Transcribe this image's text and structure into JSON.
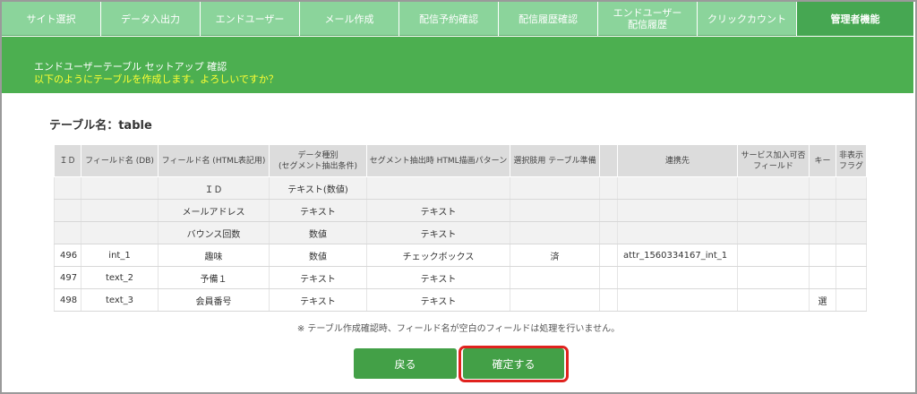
{
  "nav": {
    "tabs": [
      {
        "label": "サイト選択",
        "label2": ""
      },
      {
        "label": "データ入出力",
        "label2": ""
      },
      {
        "label": "エンドユーザー",
        "label2": ""
      },
      {
        "label": "メール作成",
        "label2": ""
      },
      {
        "label": "配信予約確認",
        "label2": ""
      },
      {
        "label": "配信履歴確認",
        "label2": ""
      },
      {
        "label": "エンドユーザー",
        "label2": "配信履歴"
      },
      {
        "label": "クリックカウント",
        "label2": ""
      },
      {
        "label": "管理者機能",
        "label2": ""
      }
    ]
  },
  "header": {
    "title": "エンドユーザーテーブル セットアップ 確認",
    "subtitle": "以下のようにテーブルを作成します。よろしいですか？"
  },
  "table_name": "テーブル名：table",
  "table": {
    "headers": [
      {
        "line1": "ＩＤ",
        "line2": ""
      },
      {
        "line1": "フィールド名 (DB)",
        "line2": ""
      },
      {
        "line1": "フィールド名 (HTML表記用)",
        "line2": ""
      },
      {
        "line1": "データ種別",
        "line2": "(セグメント抽出条件)"
      },
      {
        "line1": "セグメント抽出時 HTML描画パターン",
        "line2": ""
      },
      {
        "line1": "選択肢用 テーブル準備",
        "line2": ""
      },
      {
        "line1": "",
        "line2": ""
      },
      {
        "line1": "連携先",
        "line2": ""
      },
      {
        "line1": "サービス加入可否",
        "line2": "フィールド"
      },
      {
        "line1": "キー",
        "line2": ""
      },
      {
        "line1": "非表示",
        "line2": "フラグ"
      }
    ],
    "rows": [
      {
        "id": "",
        "db": "",
        "html": "ＩＤ",
        "type": "テキスト(数値)",
        "pattern": "",
        "prep": "",
        "blank": "",
        "link": "",
        "service": "",
        "key": "",
        "hidden": ""
      },
      {
        "id": "",
        "db": "",
        "html": "メールアドレス",
        "type": "テキスト",
        "pattern": "テキスト",
        "prep": "",
        "blank": "",
        "link": "",
        "service": "",
        "key": "",
        "hidden": ""
      },
      {
        "id": "",
        "db": "",
        "html": "バウンス回数",
        "type": "数値",
        "pattern": "テキスト",
        "prep": "",
        "blank": "",
        "link": "",
        "service": "",
        "key": "",
        "hidden": ""
      },
      {
        "id": "496",
        "db": "int_1",
        "html": "趣味",
        "type": "数値",
        "pattern": "チェックボックス",
        "prep": "済",
        "blank": "",
        "link": "attr_1560334167_int_1",
        "service": "",
        "key": "",
        "hidden": ""
      },
      {
        "id": "497",
        "db": "text_2",
        "html": "予備１",
        "type": "テキスト",
        "pattern": "テキスト",
        "prep": "",
        "blank": "",
        "link": "",
        "service": "",
        "key": "",
        "hidden": ""
      },
      {
        "id": "498",
        "db": "text_3",
        "html": "会員番号",
        "type": "テキスト",
        "pattern": "テキスト",
        "prep": "",
        "blank": "",
        "link": "",
        "service": "",
        "key": "選",
        "hidden": ""
      }
    ]
  },
  "note": "※ テーブル作成確認時、フィールド名が空白のフィールドは処理を行いません。",
  "buttons": {
    "back": "戻る",
    "confirm": "確定する"
  }
}
